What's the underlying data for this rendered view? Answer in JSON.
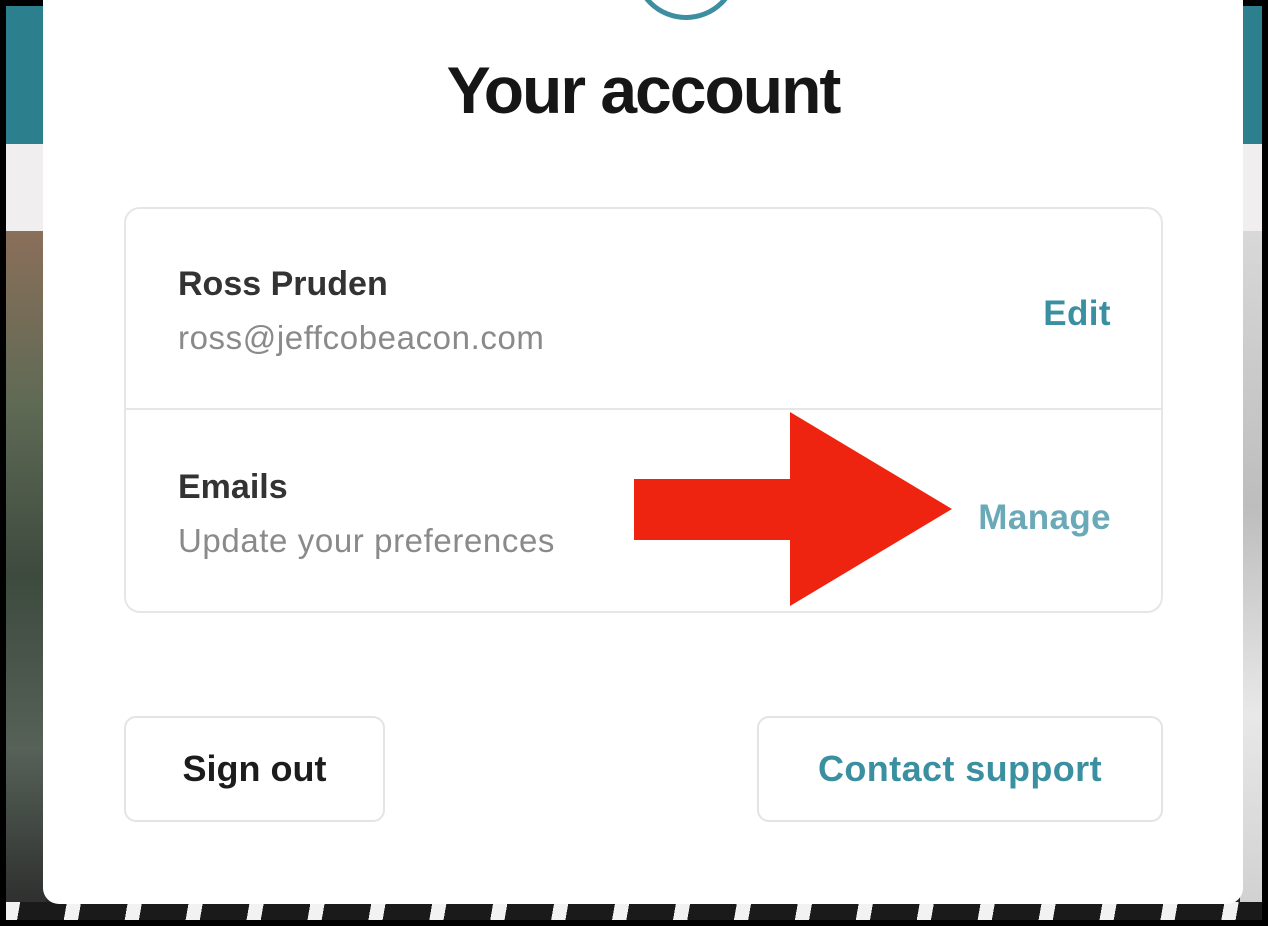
{
  "modal": {
    "title": "Your account"
  },
  "profile": {
    "name": "Ross Pruden",
    "email": "ross@jeffcobeacon.com",
    "action_label": "Edit"
  },
  "emails": {
    "title": "Emails",
    "subtitle": "Update your preferences",
    "action_label": "Manage"
  },
  "buttons": {
    "sign_out": "Sign out",
    "contact_support": "Contact support"
  },
  "annotation": {
    "arrow_color": "#ee2410",
    "arrow_direction": "right",
    "points_to": "Manage"
  },
  "colors": {
    "accent": "#3a8fa0",
    "header_bar": "#2c7f8c"
  }
}
